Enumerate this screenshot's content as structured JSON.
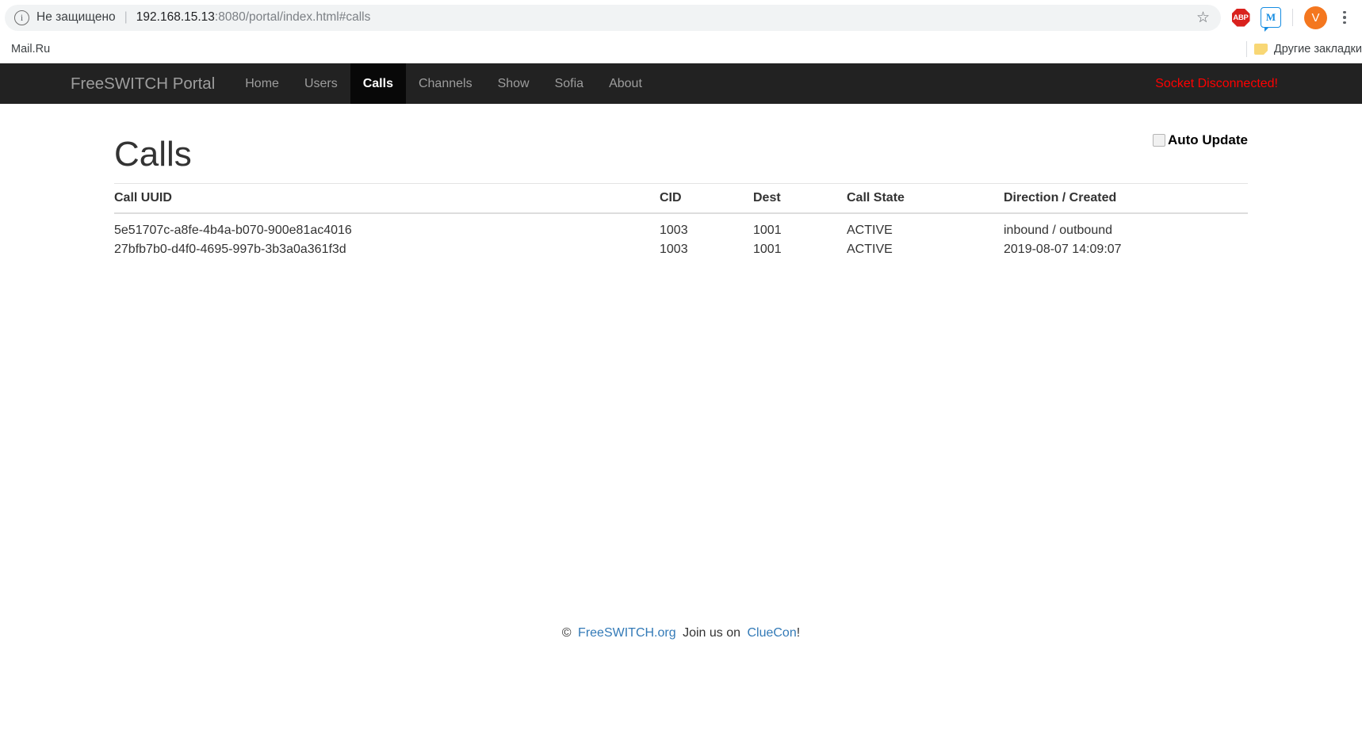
{
  "browser": {
    "security_label": "Не защищено",
    "separator": "|",
    "url_host": "192.168.15.13",
    "url_rest": ":8080/portal/index.html#calls",
    "info_icon_glyph": "i",
    "star_icon_glyph": "☆",
    "extensions": [
      {
        "name": "adblock-plus",
        "label": "ABP"
      },
      {
        "name": "mailru",
        "label": "M"
      }
    ],
    "avatar_letter": "V",
    "bookmarks": [
      {
        "label": "Mail.Ru"
      }
    ],
    "other_bookmarks_label": "Другие закладки"
  },
  "navbar": {
    "brand": "FreeSWITCH Portal",
    "links": [
      {
        "label": "Home",
        "active": false
      },
      {
        "label": "Users",
        "active": false
      },
      {
        "label": "Calls",
        "active": true
      },
      {
        "label": "Channels",
        "active": false
      },
      {
        "label": "Show",
        "active": false
      },
      {
        "label": "Sofia",
        "active": false
      },
      {
        "label": "About",
        "active": false
      }
    ],
    "socket_status": "Socket Disconnected!",
    "socket_status_color": "#ff0000",
    "background_color": "#222222"
  },
  "page": {
    "title": "Calls",
    "auto_update_label": "Auto Update",
    "auto_update_checked": false
  },
  "table": {
    "headers": {
      "uuid": "Call UUID",
      "cid": "CID",
      "dest": "Dest",
      "state": "Call State",
      "direction": "Direction / Created"
    },
    "rows": [
      {
        "uuid": "5e51707c-a8fe-4b4a-b070-900e81ac4016",
        "cid": "1003",
        "dest": "1001",
        "state": "ACTIVE",
        "direction": "inbound / outbound",
        "direction_is_link": false
      },
      {
        "uuid": "27bfb7b0-d4f0-4695-997b-3b3a0a361f3d",
        "cid": "1003",
        "dest": "1001",
        "state": "ACTIVE",
        "direction": "2019-08-07 14:09:07",
        "direction_is_link": true
      }
    ]
  },
  "footer": {
    "copyright": "©",
    "link1": "FreeSWITCH.org",
    "middle": "Join us on",
    "link2": "ClueCon",
    "suffix": "!",
    "link_color": "#337ab7"
  }
}
